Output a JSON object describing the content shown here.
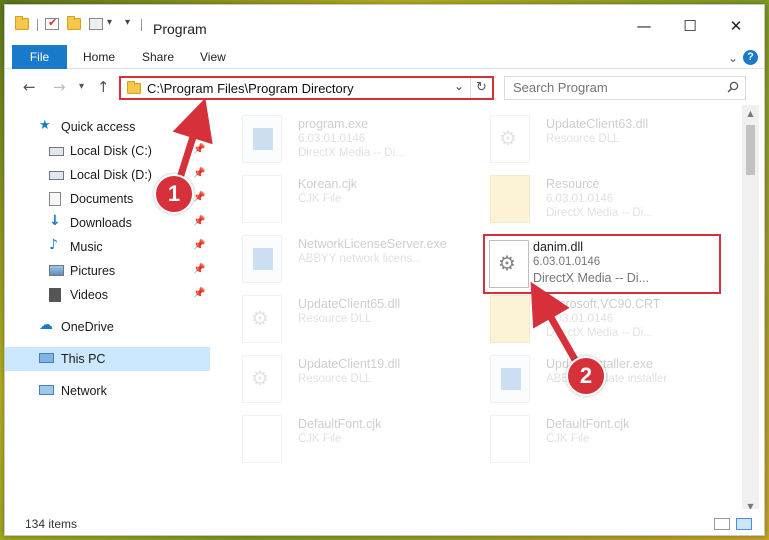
{
  "window": {
    "title": "Program",
    "controls": {
      "minimize": "—",
      "maximize": "☐",
      "close": "✕"
    }
  },
  "ribbon": {
    "tabs": [
      "File",
      "Home",
      "Share",
      "View"
    ]
  },
  "address": {
    "path": "C:\\Program Files\\Program Directory"
  },
  "search": {
    "placeholder": "Search Program"
  },
  "sidebar": {
    "items": [
      {
        "label": "Quick access",
        "icon": "star-icon",
        "pinned": false
      },
      {
        "label": "Local Disk (C:)",
        "icon": "drive-icon",
        "pinned": true
      },
      {
        "label": "Local Disk (D:)",
        "icon": "drive-icon",
        "pinned": true
      },
      {
        "label": "Documents",
        "icon": "documents-icon",
        "pinned": true
      },
      {
        "label": "Downloads",
        "icon": "download-icon",
        "pinned": true
      },
      {
        "label": "Music",
        "icon": "music-icon",
        "pinned": true
      },
      {
        "label": "Pictures",
        "icon": "pictures-icon",
        "pinned": true
      },
      {
        "label": "Videos",
        "icon": "videos-icon",
        "pinned": true
      },
      {
        "label": "OneDrive",
        "icon": "cloud-icon",
        "pinned": false
      },
      {
        "label": "This PC",
        "icon": "computer-icon",
        "pinned": false,
        "selected": true
      },
      {
        "label": "Network",
        "icon": "network-icon",
        "pinned": false
      }
    ]
  },
  "files": [
    {
      "name": "program.exe",
      "line1": "6.03.01.0146",
      "line2": "DirectX Media -- Di...",
      "icon": "exe",
      "faded": true
    },
    {
      "name": "UpdateClient63.dll",
      "line1": "Resource DLL",
      "line2": "",
      "icon": "dll",
      "faded": true
    },
    {
      "name": "Korean.cjk",
      "line1": "CJK File",
      "line2": "",
      "icon": "doc",
      "faded": true
    },
    {
      "name": "Resource",
      "line1": "6.03.01.0146",
      "line2": "DirectX Media -- Di...",
      "icon": "folder",
      "faded": true
    },
    {
      "name": "NetworkLicenseServer.exe",
      "line1": "ABBYY network licens...",
      "line2": "",
      "icon": "exe",
      "faded": true
    },
    {
      "name": "danim.dll",
      "line1": "6.03.01.0146",
      "line2": "DirectX Media -- Di...",
      "icon": "dll",
      "faded": false,
      "highlight": true
    },
    {
      "name": "UpdateClient65.dll",
      "line1": "Resource DLL",
      "line2": "",
      "icon": "dll",
      "faded": true
    },
    {
      "name": "Microsoft.VC90.CRT",
      "line1": "6.03.01.0146",
      "line2": "DirectX Media -- Di...",
      "icon": "folder",
      "faded": true
    },
    {
      "name": "UpdateClient19.dll",
      "line1": "Resource DLL",
      "line2": "",
      "icon": "dll",
      "faded": true
    },
    {
      "name": "UpdateInstaller.exe",
      "line1": "ABBYY Update installer",
      "line2": "",
      "icon": "exe",
      "faded": true
    },
    {
      "name": "DefaultFont.cjk",
      "line1": "CJK File",
      "line2": "",
      "icon": "doc",
      "faded": true
    },
    {
      "name": "DefaultFont.cjk",
      "line1": "CJK File",
      "line2": "",
      "icon": "doc",
      "faded": true
    }
  ],
  "status": {
    "item_count": "134 items"
  },
  "annotations": {
    "step1": "1",
    "step2": "2",
    "color": "#d6313a"
  }
}
